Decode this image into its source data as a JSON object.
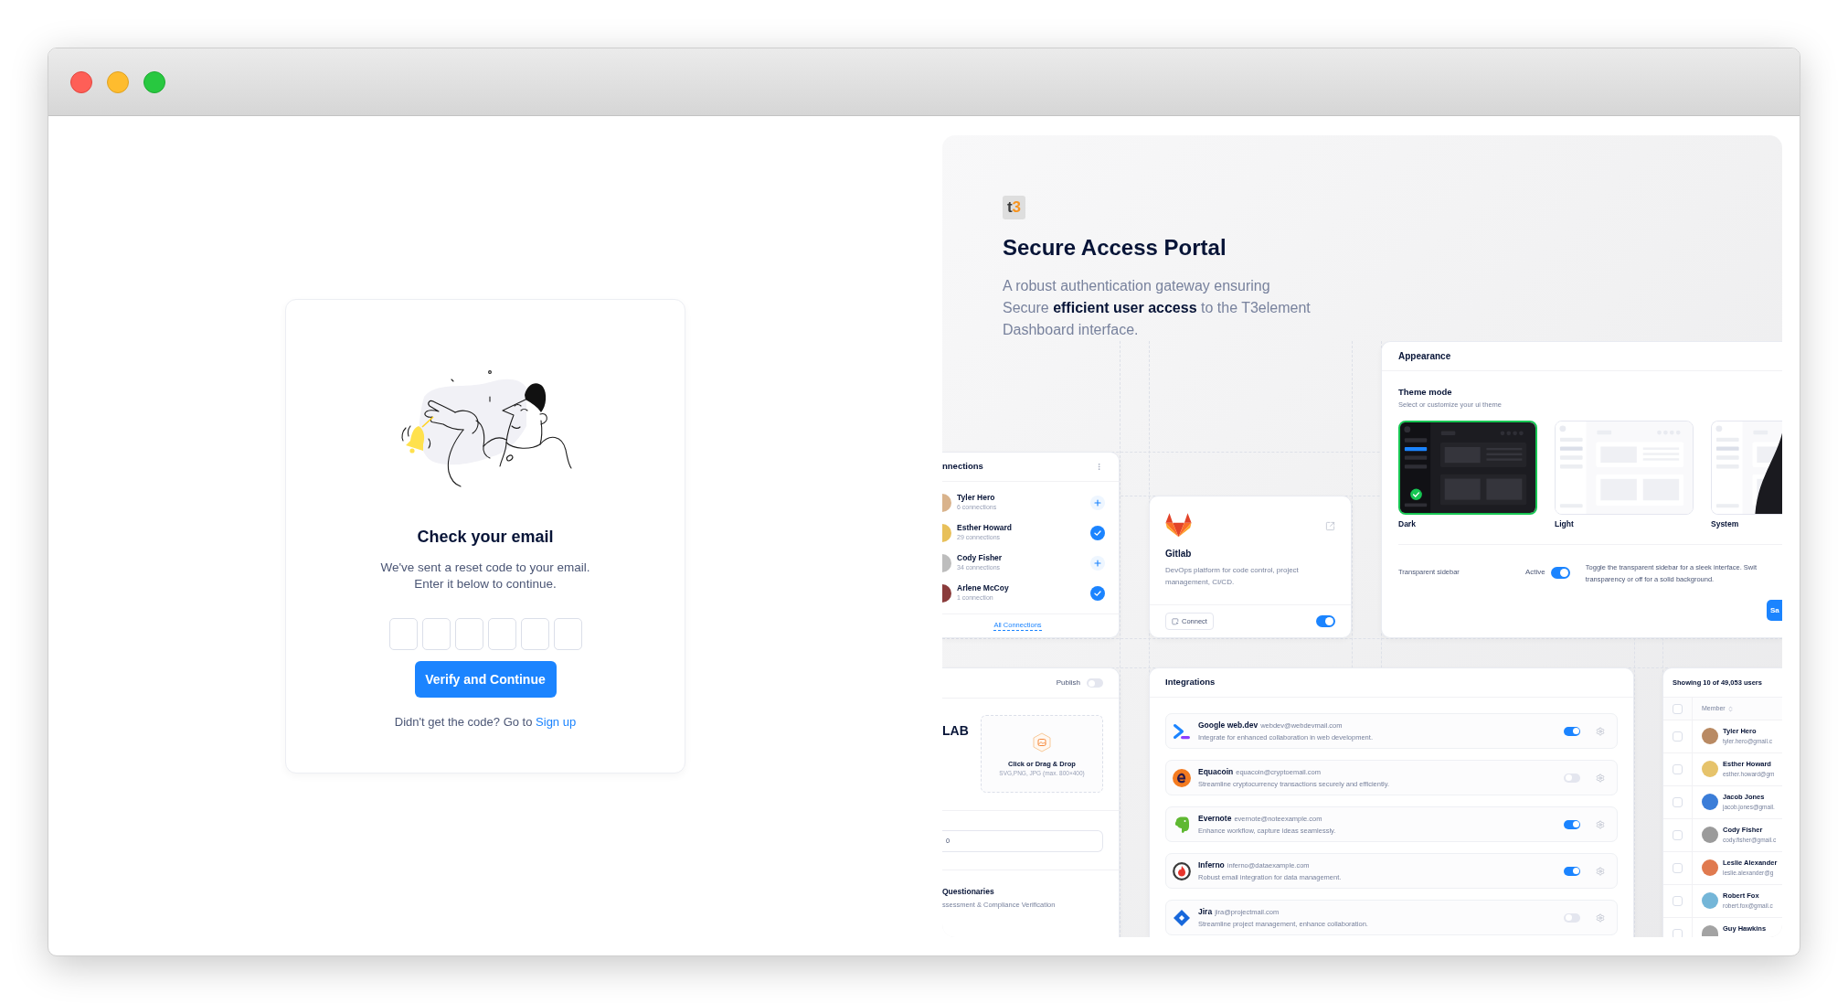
{
  "verify": {
    "title": "Check your email",
    "message": [
      "We've sent a reset code to your email.",
      "Enter it below to continue."
    ],
    "code_fields": [
      {
        "focused": false
      },
      {
        "focused": false
      },
      {
        "focused": false
      },
      {
        "focused": false
      },
      {
        "focused": false
      },
      {
        "focused": false
      }
    ],
    "button": "Verify and Continue",
    "footer": {
      "text": "Didn't get the code? Go to",
      "link": "Sign up"
    }
  },
  "showcase": {
    "logo": [
      "t",
      "3"
    ],
    "title": "Secure Access Portal",
    "description": [
      "A robust authentication gateway ensuring",
      "Secure **efficient user access** to the T3element",
      "Dashboard interface."
    ]
  },
  "connections": {
    "title": "nnections",
    "people": [
      {
        "name": "Tyler Hero",
        "count": "6 connections",
        "connected": false
      },
      {
        "name": "Esther Howard",
        "count": "29 connections",
        "connected": true
      },
      {
        "name": "Cody Fisher",
        "count": "34 connections",
        "connected": false
      },
      {
        "name": "Arlene McCoy",
        "count": "1 connection",
        "connected": true
      }
    ],
    "link": "All Connections"
  },
  "gitlab": {
    "title": "Gitlab",
    "description": "DevOps platform for code control, project management, CI/CD.",
    "button": "Connect",
    "on": true
  },
  "appearance": {
    "title": "Appearance",
    "section_title": "Theme mode",
    "section_subtitle": "Select or customize your ui theme",
    "themes": [
      {
        "label": "Dark",
        "kind": "dark",
        "selected": true
      },
      {
        "label": "Light",
        "kind": "light",
        "selected": false
      },
      {
        "label": "System",
        "kind": "system",
        "selected": false
      }
    ],
    "setting": {
      "label": "Transparent sidebar",
      "status": "Active",
      "on": true,
      "description": [
        "Toggle the transparent sidebar for a sleek interface. Swit",
        "transparency or off for a solid background."
      ]
    },
    "button": "Sa"
  },
  "publish_form": {
    "publish_label": "Publish",
    "publish_on": false,
    "title": "LAB",
    "upload": {
      "title": "Click or Drag & Drop",
      "hint": "SVG,PNG, JPG (max. 800×400)"
    },
    "field_value": "0",
    "section_title": "Questionaries",
    "section_subtitle": "ssessment & Compliance Verification"
  },
  "integrations": {
    "title": "Integrations",
    "items": [
      {
        "kind": "chevron",
        "name": "Google web.dev",
        "email": "webdev@webdevmail.com",
        "description": "Integrate for enhanced collaboration in web development.",
        "on": true
      },
      {
        "kind": "coin",
        "name": "Equacoin",
        "email": "equacoin@cryptoemail.com",
        "description": "Streamline cryptocurrency transactions securely and efficiently.",
        "on": false
      },
      {
        "kind": "elephant",
        "name": "Evernote",
        "email": "evernote@noteexample.com",
        "description": "Enhance workflow, capture ideas seamlessly.",
        "on": true
      },
      {
        "kind": "flame",
        "name": "Inferno",
        "email": "inferno@dataexample.com",
        "description": "Robust email integration for data management.",
        "on": true
      },
      {
        "kind": "diamond",
        "name": "Jira",
        "email": "jira@projectmail.com",
        "description": "Streamline project management, enhance collaboration.",
        "on": false
      }
    ]
  },
  "users": {
    "summary": "Showing 10 of 49,053 users",
    "all_checked": false,
    "column": "Member",
    "rows": [
      {
        "name": "Tyler Hero",
        "email": "tyler.hero@gmail.c",
        "checked": false
      },
      {
        "name": "Esther Howard",
        "email": "esther.howard@gm",
        "checked": false
      },
      {
        "name": "Jacob Jones",
        "email": "jacob.jones@gmail.",
        "checked": false
      },
      {
        "name": "Cody Fisher",
        "email": "cody.fisher@gmail.c",
        "checked": false
      },
      {
        "name": "Leslie Alexander",
        "email": "leslie.alexander@g",
        "checked": false
      },
      {
        "name": "Robert Fox",
        "email": "robert.fox@gmail.c",
        "checked": false
      },
      {
        "name": "Guy Hawkins",
        "checked": false
      }
    ]
  }
}
